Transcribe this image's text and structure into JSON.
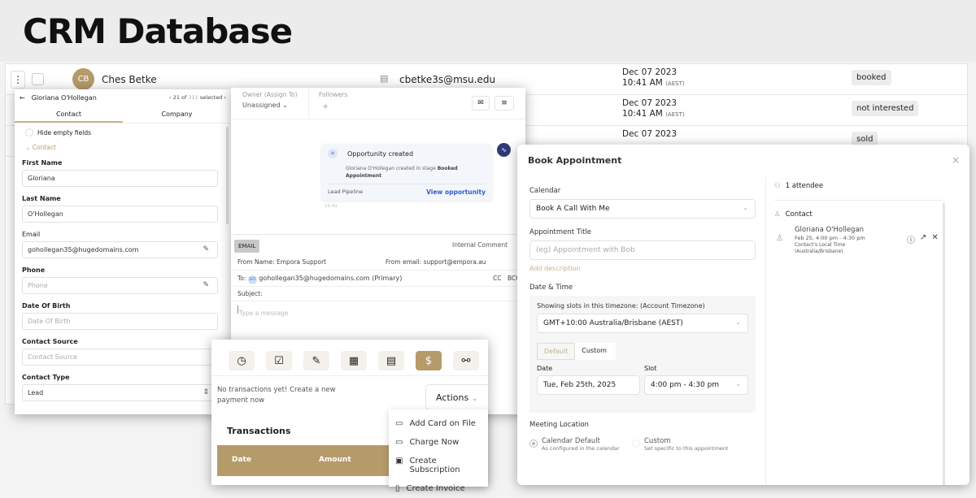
{
  "header": {
    "title": "CRM Database"
  },
  "table": {
    "rows": [
      {
        "initials": "CB",
        "name": "Ches Betke",
        "email": "cbetke3s@msu.edu",
        "date": "Dec 07 2023",
        "time": "10:41 AM",
        "tz": "(AEST)",
        "tag": "booked"
      },
      {
        "date": "Dec 07 2023",
        "time": "10:41 AM",
        "tz": "(AEST)",
        "tag": "not interested"
      },
      {
        "date": "Dec 07 2023",
        "tag": "sold"
      }
    ]
  },
  "contact_panel": {
    "name": "Gloriana O'Hollegan",
    "pager": "21 of",
    "pager_total": "311",
    "pager_suffix": "selected",
    "tabs": [
      "Contact",
      "Company"
    ],
    "hide_empty": "Hide empty fields",
    "section": "Contact",
    "fields": [
      {
        "label": "First Name",
        "value": "Gloriana"
      },
      {
        "label": "Last Name",
        "value": "O'Hollegan"
      },
      {
        "label": "Email",
        "value": "gohollegan35@hugedomains.com"
      },
      {
        "label": "Phone",
        "placeholder": "Phone"
      },
      {
        "label": "Date Of Birth",
        "placeholder": "Date Of Birth"
      },
      {
        "label": "Contact Source",
        "placeholder": "Contact Source"
      },
      {
        "label": "Contact Type",
        "value": "Lead"
      }
    ]
  },
  "conversation": {
    "owner_label": "Owner (Assign To)",
    "owner_value": "Unassigned",
    "followers_label": "Followers",
    "followers_add": "+",
    "card": {
      "title": "Opportunity created",
      "body": "Gloriana O'Hollegan created in stage",
      "stage": "Booked Appointment",
      "pipeline": "Lead Pipeline",
      "link": "View opportunity",
      "time": "10:41"
    },
    "email_tab": "EMAIL",
    "internal": "Internal Comment",
    "from_name_label": "From Name:",
    "from_name": "Empora Support",
    "from_email_label": "From email:",
    "from_email": "support@empora.au",
    "to_label": "To:",
    "to_initials": "GO",
    "to_value": "gohollegan35@hugedomains.com (Primary)",
    "cc": "CC",
    "bcc": "BCC",
    "subject_label": "Subject:",
    "message_placeholder": "Type a message"
  },
  "payments": {
    "empty": "No transactions yet! Create a new payment now",
    "actions": "Actions",
    "transactions": "Transactions",
    "columns": [
      "Date",
      "Amount"
    ],
    "menu": [
      "Add Card on File",
      "Charge Now",
      "Create Subscription",
      "Create Invoice"
    ]
  },
  "appointment": {
    "title": "Book Appointment",
    "calendar_label": "Calendar",
    "calendar_value": "Book A Call With Me",
    "title_label": "Appointment Title",
    "title_placeholder": "(eg) Appointment with Bob",
    "add_desc": "Add description",
    "dt_label": "Date & Time",
    "tz_label": "Showing slots in this timezone: (Account Timezone)",
    "tz_value": "GMT+10:00 Australia/Brisbane (AEST)",
    "tabs": [
      "Default",
      "Custom"
    ],
    "date_label": "Date",
    "date_value": "Tue, Feb 25th, 2025",
    "slot_label": "Slot",
    "slot_value": "4:00 pm - 4:30 pm",
    "loc_label": "Meeting Location",
    "loc_options": [
      {
        "title": "Calendar Default",
        "sub": "As configured in the calendar"
      },
      {
        "title": "Custom",
        "sub": "Set specific to this appointment"
      }
    ],
    "attendees": "1 attendee",
    "contact_heading": "Contact",
    "contact_name": "Gloriana O'Hollegan",
    "contact_time": "Feb 25, 4:00 pm - 4:30 pm",
    "contact_local": "Contact's Local Time",
    "contact_tz": "(Australia/Brisbane)"
  },
  "colors": {
    "accent": "#b59a6a",
    "blue": "#2f5fd0",
    "navy": "#2f3a78"
  }
}
